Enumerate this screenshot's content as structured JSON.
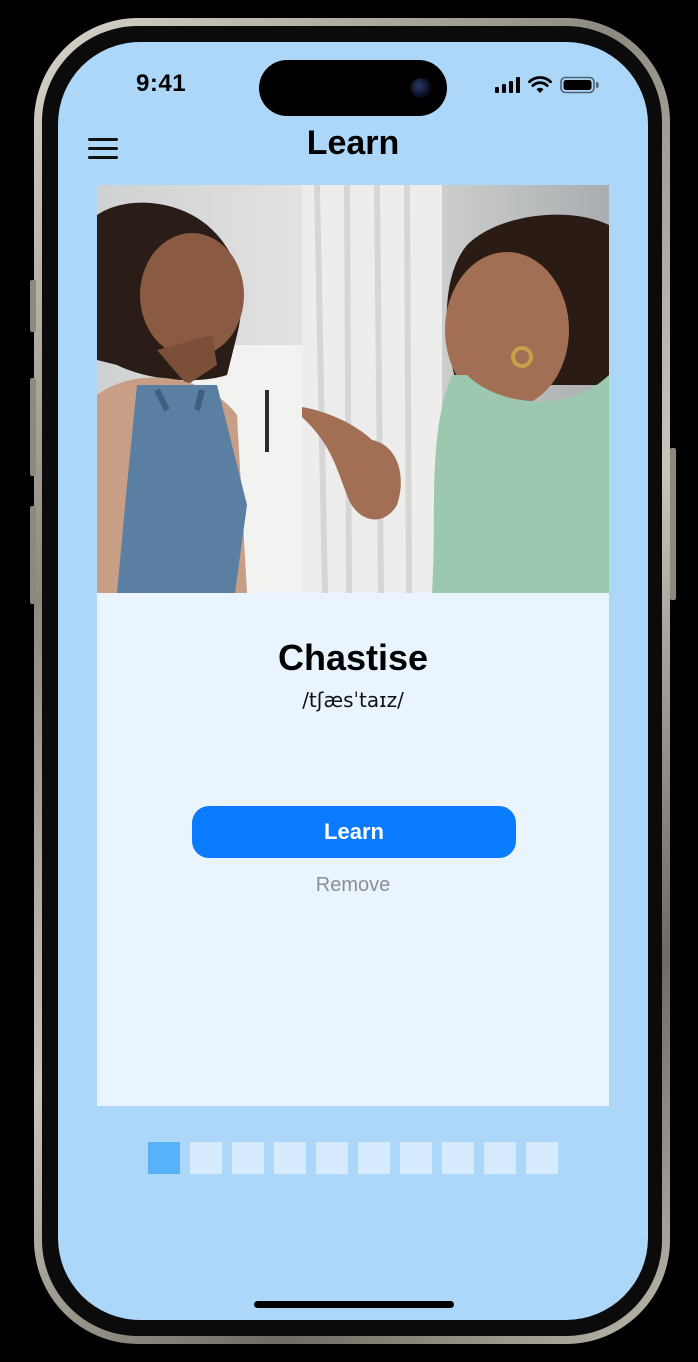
{
  "status_bar": {
    "time": "9:41"
  },
  "header": {
    "title": "Learn",
    "menu_icon": "hamburger-menu-icon"
  },
  "card": {
    "image_description_icon": "photo-mother-scolding-child",
    "word": "Chastise",
    "pronunciation": "/tʃæsˈtaɪz/",
    "learn_label": "Learn",
    "remove_label": "Remove"
  },
  "pager": {
    "total": 10,
    "active_index": 0
  },
  "colors": {
    "screen_bg": "#acd7f9",
    "card_bg": "#e9f4fe",
    "primary": "#0a7aff",
    "pager_active": "#57b2f9",
    "pager_inactive": "#d6ebfd",
    "muted_text": "#8c8f93"
  }
}
